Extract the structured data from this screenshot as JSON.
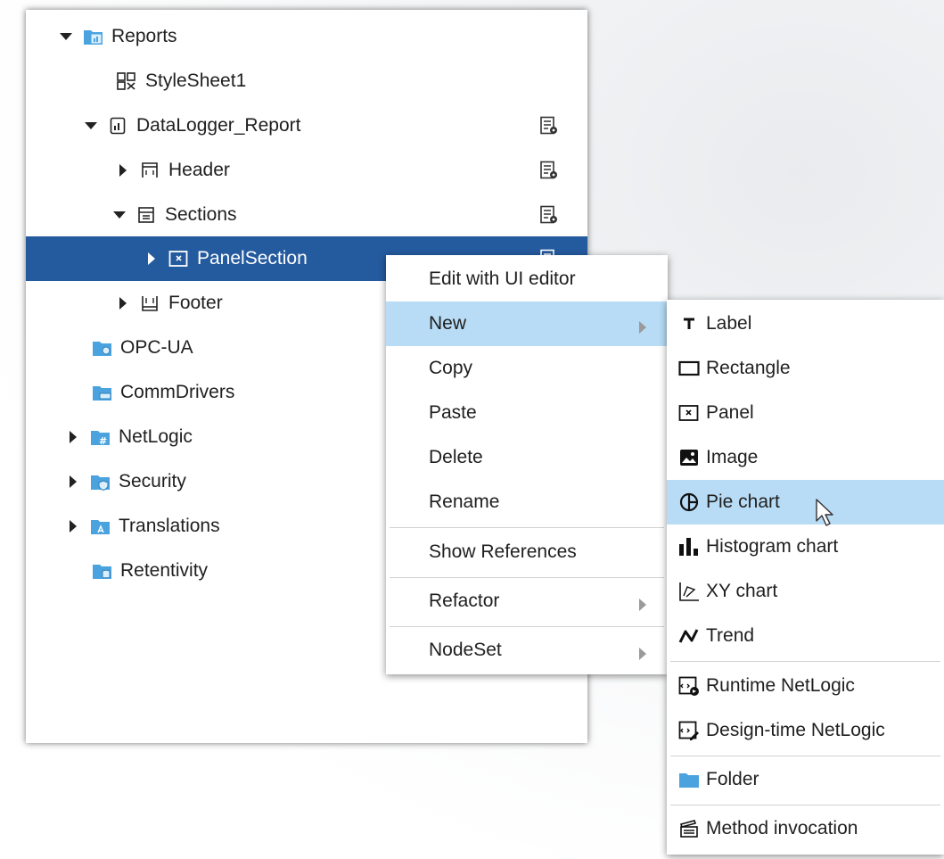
{
  "tree": {
    "items": [
      {
        "label": "Reports",
        "icon": "reports-folder-icon"
      },
      {
        "label": "StyleSheet1",
        "icon": "stylesheet-icon"
      },
      {
        "label": "DataLogger_Report",
        "icon": "report-icon"
      },
      {
        "label": "Header",
        "icon": "header-icon"
      },
      {
        "label": "Sections",
        "icon": "sections-icon"
      },
      {
        "label": "PanelSection",
        "icon": "panel-icon"
      },
      {
        "label": "Footer",
        "icon": "footer-icon"
      },
      {
        "label": "OPC-UA",
        "icon": "opcua-folder-icon"
      },
      {
        "label": "CommDrivers",
        "icon": "commdrivers-folder-icon"
      },
      {
        "label": "NetLogic",
        "icon": "netlogic-folder-icon"
      },
      {
        "label": "Security",
        "icon": "security-folder-icon"
      },
      {
        "label": "Translations",
        "icon": "translations-folder-icon"
      },
      {
        "label": "Retentivity",
        "icon": "retentivity-folder-icon"
      }
    ]
  },
  "context_menu": {
    "items": [
      "Edit with UI editor",
      "New",
      "Copy",
      "Paste",
      "Delete",
      "Rename",
      "Show References",
      "Refactor",
      "NodeSet"
    ]
  },
  "new_submenu": {
    "items": [
      "Label",
      "Rectangle",
      "Panel",
      "Image",
      "Pie chart",
      "Histogram chart",
      "XY chart",
      "Trend",
      "Runtime NetLogic",
      "Design-time NetLogic",
      "Folder",
      "Method invocation"
    ]
  },
  "colors": {
    "selection": "#245a9e",
    "hover": "#b8dcf5",
    "folder": "#4aa3df"
  }
}
